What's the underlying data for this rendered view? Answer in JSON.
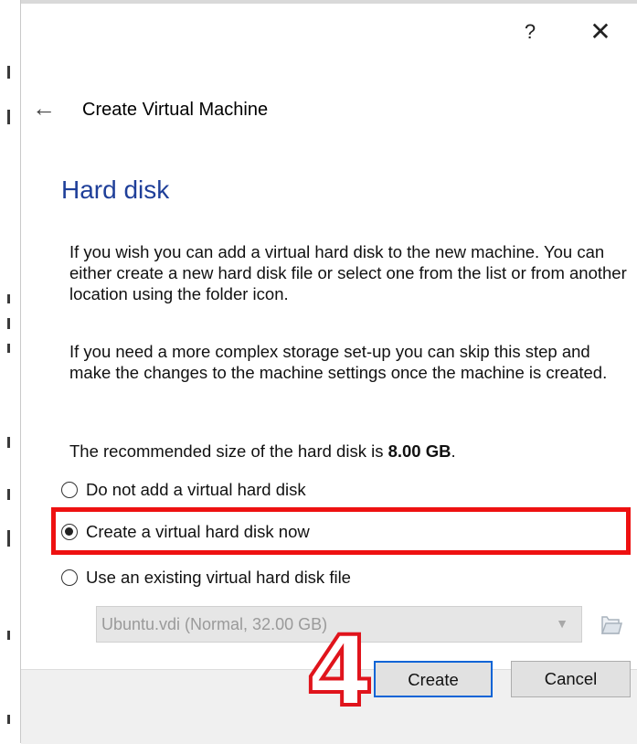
{
  "titlebar": {
    "help_label": "?",
    "close_label": "✕"
  },
  "wizard": {
    "back_label": "←",
    "title": "Create Virtual Machine"
  },
  "section": {
    "title": "Hard disk",
    "paragraph1": "If you wish you can add a virtual hard disk to the new machine. You can either create a new hard disk file or select one from the list or from another location using the folder icon.",
    "paragraph2": "If you need a more complex storage set-up you can skip this step and make the changes to the machine settings once the machine is created.",
    "recommended_prefix": "The recommended size of the hard disk is ",
    "recommended_size": "8.00 GB",
    "recommended_suffix": "."
  },
  "options": [
    {
      "label": "Do not add a virtual hard disk",
      "checked": false
    },
    {
      "label": "Create a virtual hard disk now",
      "checked": true
    },
    {
      "label": "Use an existing virtual hard disk file",
      "checked": false
    }
  ],
  "disk_select": {
    "value": "Ubuntu.vdi (Normal, 32.00 GB)",
    "enabled": false
  },
  "annotation": {
    "step_number": "4",
    "highlight_color": "#ee1111"
  },
  "buttons": {
    "create": "Create",
    "cancel": "Cancel"
  },
  "colors": {
    "section_title": "#1f3f99",
    "default_button_border": "#0a64d6"
  }
}
